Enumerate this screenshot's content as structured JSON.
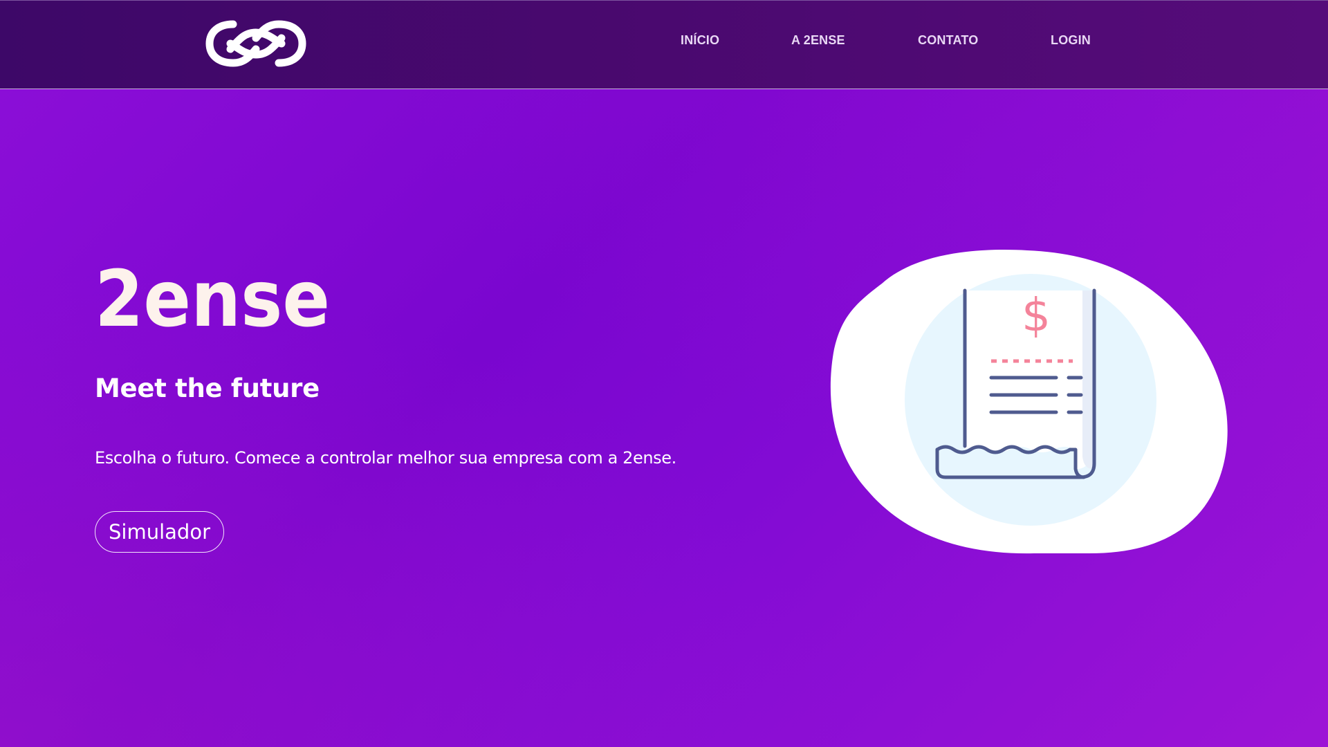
{
  "nav": {
    "logo_icon": "infinity-icon",
    "links": [
      {
        "label": "INÍCIO"
      },
      {
        "label": "A 2ENSE"
      },
      {
        "label": "CONTATO"
      },
      {
        "label": "LOGIN"
      }
    ]
  },
  "hero": {
    "brand": "2ense",
    "tagline": "Meet the future",
    "description": "Escolha o futuro. Comece a controlar melhor sua empresa com a 2ense.",
    "button_label": "Simulador"
  },
  "illustration": {
    "icon": "receipt-icon",
    "symbol": "$"
  },
  "colors": {
    "nav_bg": "#4a096f",
    "hero_bg": "#7a06cf",
    "brand_text": "#fdf2ec",
    "receipt_stroke": "#4f5b8f",
    "accent_pink": "#f4839a",
    "blob_bg": "#ffffff",
    "circle_bg": "#e7f6fe"
  }
}
